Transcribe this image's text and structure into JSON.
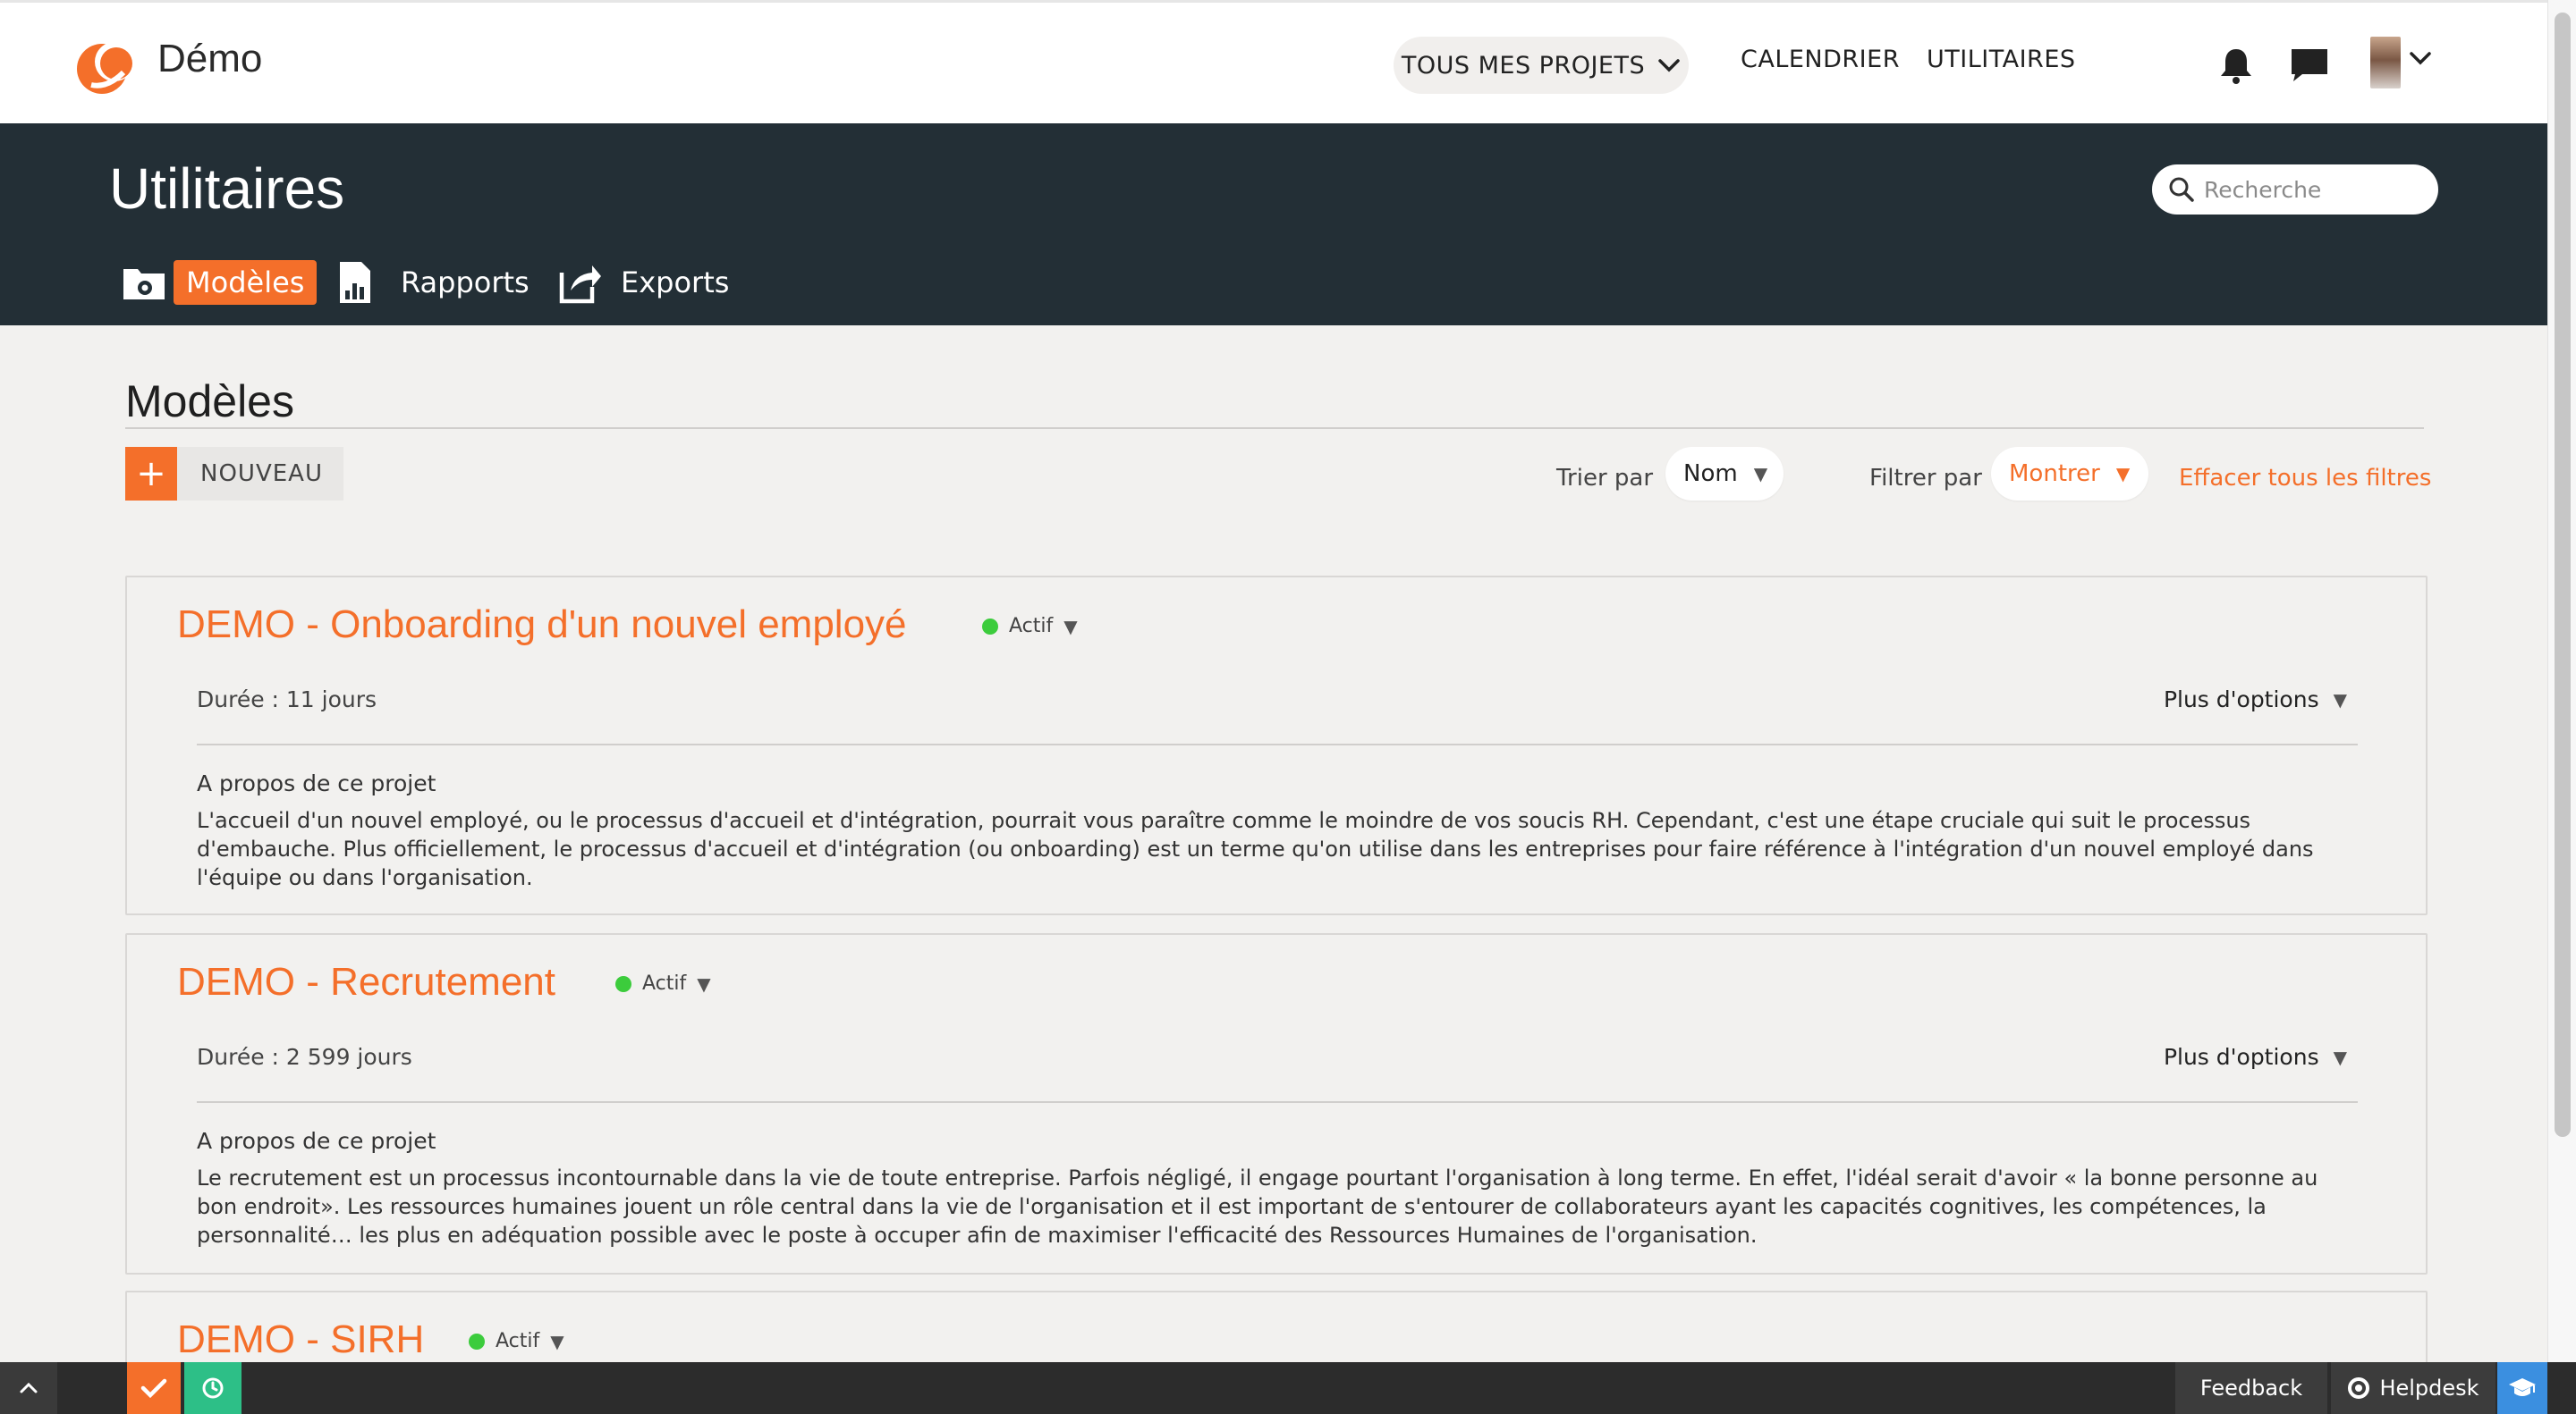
{
  "app": {
    "brand": "Démo",
    "nav": {
      "projects": "TOUS MES PROJETS",
      "calendar": "CALENDRIER",
      "utilities": "UTILITAIRES"
    },
    "icons": [
      "app-logo-icon",
      "bell-icon",
      "chat-icon",
      "avatar",
      "chevron-down-icon"
    ]
  },
  "header": {
    "title": "Utilitaires",
    "search_placeholder": "Recherche",
    "tabs": [
      {
        "label": "Modèles",
        "icon": "folder-gear-icon",
        "active": true
      },
      {
        "label": "Rapports",
        "icon": "report-chart-icon",
        "active": false
      },
      {
        "label": "Exports",
        "icon": "export-icon",
        "active": false
      }
    ]
  },
  "main": {
    "title": "Modèles",
    "new_label": "NOUVEAU",
    "sort_label": "Trier par",
    "sort_value": "Nom",
    "filter_label": "Filtrer par",
    "filter_value": "Montrer",
    "clear_filters": "Effacer tous les filtres",
    "more_options": "Plus d'options",
    "about": "A propos de ce projet",
    "cards": [
      {
        "title": "DEMO - Onboarding d'un nouvel employé",
        "status": "Actif",
        "duration": "Durée : 11 jours",
        "description": "L'accueil d'un nouvel employé, ou le processus d'accueil et d'intégration, pourrait vous paraître comme le moindre de vos soucis RH. Cependant, c'est une étape cruciale qui suit le processus d'embauche. Plus officiellement, le processus d'accueil et d'intégration (ou onboarding) est un terme qu'on utilise dans les entreprises pour faire référence à l'intégration d'un nouvel employé dans l'équipe ou dans l'organisation."
      },
      {
        "title": "DEMO - Recrutement",
        "status": "Actif",
        "duration": "Durée : 2 599 jours",
        "description": "Le recrutement est un processus incontournable dans la vie de toute entreprise. Parfois négligé, il engage pourtant l'organisation à long terme. En effet, l'idéal serait d'avoir « la bonne personne au bon endroit». Les ressources humaines jouent un rôle central dans la vie de l'organisation et il est important de s'entourer de collaborateurs ayant les capacités cognitives, les compétences, la personnalité… les plus en adéquation possible avec le poste à occuper afin de maximiser l'efficacité des Ressources Humaines de l'organisation."
      },
      {
        "title": "DEMO - SIRH",
        "status": "Actif"
      }
    ]
  },
  "bottombar": {
    "feedback": "Feedback",
    "helpdesk": "Helpdesk"
  },
  "colors": {
    "accent": "#f46f2a",
    "header_bg": "#232f36",
    "status_active": "#3ccc3c",
    "timer_green": "#2dbf87",
    "grad_blue": "#3b8fe0"
  }
}
